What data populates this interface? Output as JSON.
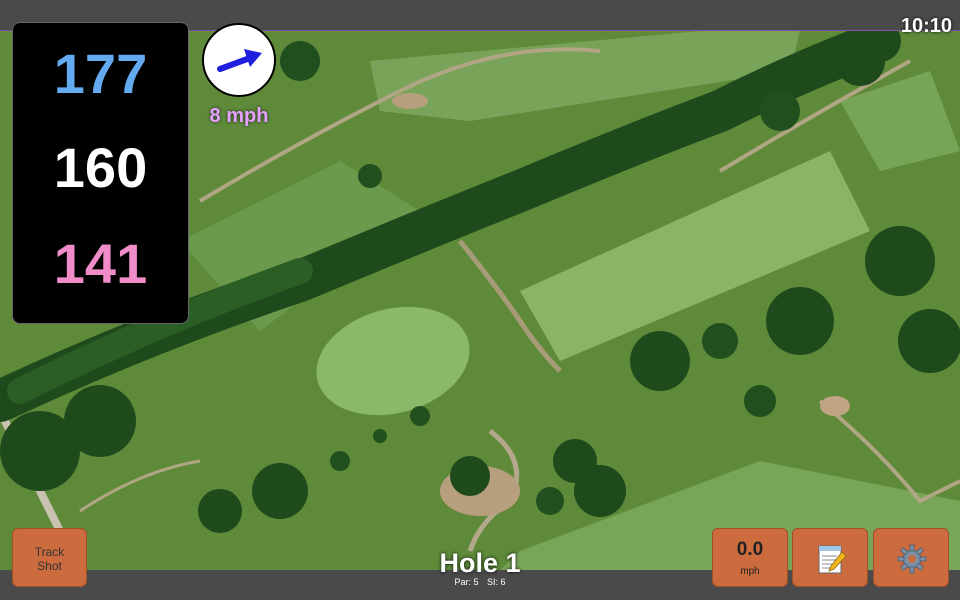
{
  "status": {
    "time": "10:10"
  },
  "yardage": {
    "back": "177",
    "middle": "160",
    "front": "141"
  },
  "wind": {
    "speed": "8 mph",
    "icon": "wind-arrow-icon"
  },
  "buttons": {
    "track_shot": "Track Shot",
    "speed_value": "0.0",
    "speed_unit": "mph",
    "notes_icon": "notepad-icon",
    "settings_icon": "gear-icon"
  },
  "hole": {
    "title": "Hole 1",
    "par": "Par: 5",
    "si": "SI: 6"
  },
  "colors": {
    "back_yardage": "#64aaf0",
    "middle_yardage": "#ffffff",
    "front_yardage": "#f08cc8",
    "wind_text": "#e6a0ff",
    "button": "#cc6b3d"
  }
}
